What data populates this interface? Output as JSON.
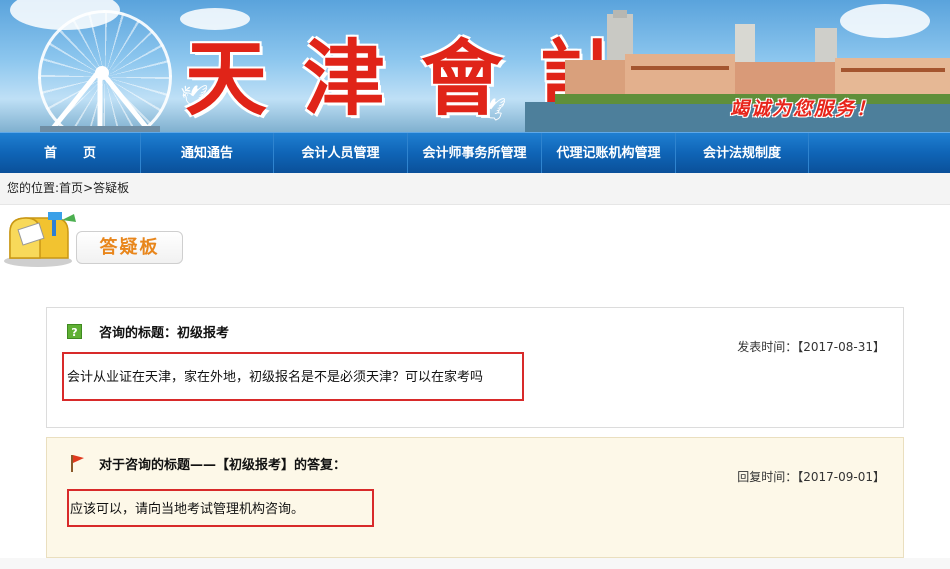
{
  "banner": {
    "title": "天津會計",
    "slogan": "竭诚为您服务！"
  },
  "nav": {
    "items": [
      {
        "label": "首　　页",
        "name": "nav-home"
      },
      {
        "label": "通知通告",
        "name": "nav-notices"
      },
      {
        "label": "会计人员管理",
        "name": "nav-accountant-management"
      },
      {
        "label": "会计师事务所管理",
        "name": "nav-firm-management"
      },
      {
        "label": "代理记账机构管理",
        "name": "nav-agency-management"
      },
      {
        "label": "会计法规制度",
        "name": "nav-regulations"
      },
      {
        "label": "",
        "name": "nav-blank"
      }
    ]
  },
  "breadcrumb": {
    "prefix": "您的位置:",
    "home": "首页",
    "separator": ">",
    "current": "答疑板"
  },
  "section": {
    "title": "答疑板"
  },
  "question": {
    "title": "咨询的标题：初级报考",
    "time_label": "发表时间：【2017-08-31】",
    "body": "会计从业证在天津，家在外地，初级报名是不是必须天津？可以在家考吗"
  },
  "answer": {
    "title": "对于咨询的标题——【初级报考】的答复：",
    "time_label": "回复时间：【2017-09-01】",
    "body": "应该可以，请向当地考试管理机构咨询。"
  },
  "colors": {
    "nav_blue": "#0f64b6",
    "title_red": "#e02418",
    "tag_orange": "#e8861c",
    "highlight_red": "#d82a2a",
    "answer_bg": "#fdf8e8"
  }
}
